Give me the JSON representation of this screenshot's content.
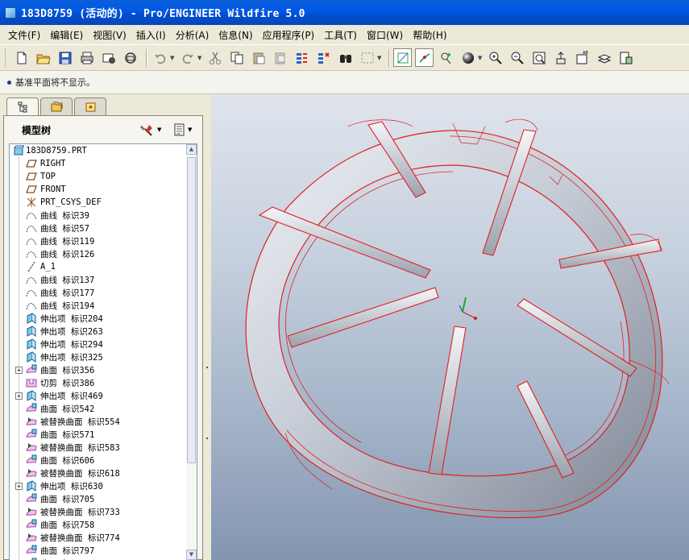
{
  "window": {
    "title": "183D8759 (活动的) - Pro/ENGINEER Wildfire 5.0"
  },
  "menu": [
    {
      "label": "文件(F)"
    },
    {
      "label": "编辑(E)"
    },
    {
      "label": "视图(V)"
    },
    {
      "label": "插入(I)"
    },
    {
      "label": "分析(A)"
    },
    {
      "label": "信息(N)"
    },
    {
      "label": "应用程序(P)"
    },
    {
      "label": "工具(T)"
    },
    {
      "label": "窗口(W)"
    },
    {
      "label": "帮助(H)"
    }
  ],
  "toolbar": {
    "buttons": [
      "new-icon",
      "open-icon",
      "save-icon",
      "print-icon",
      "send-icon",
      "mail-icon",
      "undo-icon",
      "redo-icon",
      "cut-icon",
      "copy-icon",
      "paste-icon",
      "paste-special-icon",
      "regenerate-icon",
      "regen-manager-icon",
      "find-icon",
      "select-box-icon",
      "plane-display-icon",
      "axis-display-icon",
      "point-display-icon",
      "shade-icon",
      "zoom-in-icon",
      "zoom-out-icon",
      "refit-icon",
      "reorient-icon",
      "saved-views-icon",
      "layers-icon",
      "appearance-icon"
    ]
  },
  "message": {
    "text": "基准平面将不显示。"
  },
  "navigator": {
    "tabs": [
      "model-tree-tab",
      "folder-browser-tab",
      "favorites-tab"
    ],
    "title": "模型树",
    "tree": [
      {
        "label": "183D8759.PRT",
        "icon": "part-icon",
        "root": true
      },
      {
        "label": "RIGHT",
        "icon": "datum-plane-icon"
      },
      {
        "label": "TOP",
        "icon": "datum-plane-icon"
      },
      {
        "label": "FRONT",
        "icon": "datum-plane-icon"
      },
      {
        "label": "PRT_CSYS_DEF",
        "icon": "csys-icon"
      },
      {
        "label": "曲线 标识39",
        "icon": "curve-icon"
      },
      {
        "label": "曲线 标识57",
        "icon": "curve-icon"
      },
      {
        "label": "曲线 标识119",
        "icon": "curve-icon"
      },
      {
        "label": "曲线 标识126",
        "icon": "curve-icon"
      },
      {
        "label": "A_1",
        "icon": "axis-icon"
      },
      {
        "label": "曲线 标识137",
        "icon": "curve-icon"
      },
      {
        "label": "曲线 标识177",
        "icon": "curve-icon"
      },
      {
        "label": "曲线 标识194",
        "icon": "curve-icon"
      },
      {
        "label": "伸出项 标识204",
        "icon": "protrusion-icon"
      },
      {
        "label": "伸出项 标识263",
        "icon": "protrusion-icon"
      },
      {
        "label": "伸出项 标识294",
        "icon": "protrusion-icon"
      },
      {
        "label": "伸出项 标识325",
        "icon": "protrusion-icon"
      },
      {
        "label": "曲面 标识356",
        "icon": "surface-icon",
        "expandable": true
      },
      {
        "label": "切剪 标识386",
        "icon": "cut-feature-icon"
      },
      {
        "label": "伸出项 标识469",
        "icon": "protrusion-icon",
        "expandable": true
      },
      {
        "label": "曲面 标识542",
        "icon": "surface-icon"
      },
      {
        "label": "被替换曲面 标识554",
        "icon": "replace-surface-icon"
      },
      {
        "label": "曲面 标识571",
        "icon": "surface-icon"
      },
      {
        "label": "被替换曲面 标识583",
        "icon": "replace-surface-icon"
      },
      {
        "label": "曲面 标识606",
        "icon": "surface-icon"
      },
      {
        "label": "被替换曲面 标识618",
        "icon": "replace-surface-icon"
      },
      {
        "label": "伸出项 标识630",
        "icon": "protrusion-icon",
        "expandable": true
      },
      {
        "label": "曲面 标识705",
        "icon": "surface-icon"
      },
      {
        "label": "被替换曲面 标识733",
        "icon": "replace-surface-icon"
      },
      {
        "label": "曲面 标识758",
        "icon": "surface-icon"
      },
      {
        "label": "被替换曲面 标识774",
        "icon": "replace-surface-icon"
      },
      {
        "label": "曲面 标识797",
        "icon": "surface-icon"
      },
      {
        "label": "曲面 标识",
        "icon": "surface-icon"
      }
    ]
  },
  "colors": {
    "wireframe": "#e02020",
    "model_fill": "#c8cdd6",
    "title_bar": "#0058e6"
  }
}
